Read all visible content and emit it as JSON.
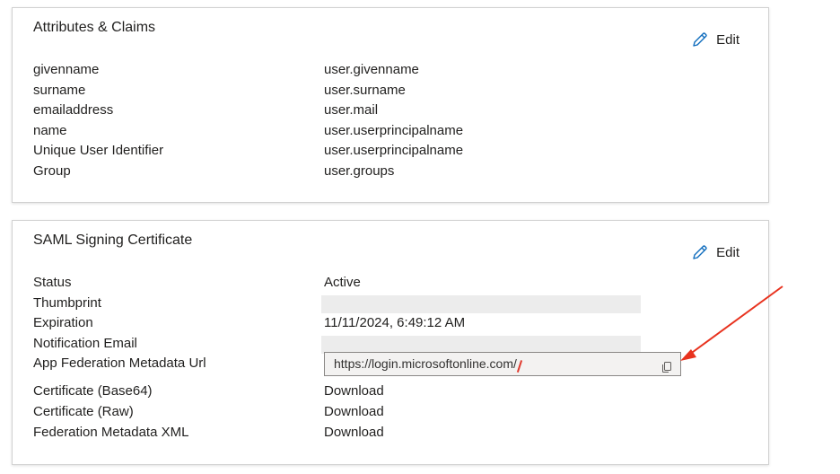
{
  "attributes_card": {
    "title": "Attributes & Claims",
    "edit_label": "Edit",
    "rows": [
      {
        "key": "givenname",
        "value": "user.givenname"
      },
      {
        "key": "surname",
        "value": "user.surname"
      },
      {
        "key": "emailaddress",
        "value": "user.mail"
      },
      {
        "key": "name",
        "value": "user.userprincipalname"
      },
      {
        "key": "Unique User Identifier",
        "value": "user.userprincipalname"
      },
      {
        "key": "Group",
        "value": "user.groups"
      }
    ]
  },
  "saml_card": {
    "title": "SAML Signing Certificate",
    "edit_label": "Edit",
    "status_label": "Status",
    "status_value": "Active",
    "thumbprint_label": "Thumbprint",
    "expiration_label": "Expiration",
    "expiration_value": "11/11/2024, 6:49:12 AM",
    "notification_email_label": "Notification Email",
    "metadata_url_label": "App Federation Metadata Url",
    "metadata_url_value": "https://login.microsoftonline.com/",
    "cert_base64_label": "Certificate (Base64)",
    "cert_raw_label": "Certificate (Raw)",
    "federation_xml_label": "Federation Metadata XML",
    "download_label": "Download"
  },
  "colors": {
    "link": "#0f6cbd",
    "annotation_arrow": "#e8321e",
    "card_border": "#d1d1d1"
  },
  "icons": {
    "edit": "pencil-icon",
    "copy": "copy-icon"
  }
}
